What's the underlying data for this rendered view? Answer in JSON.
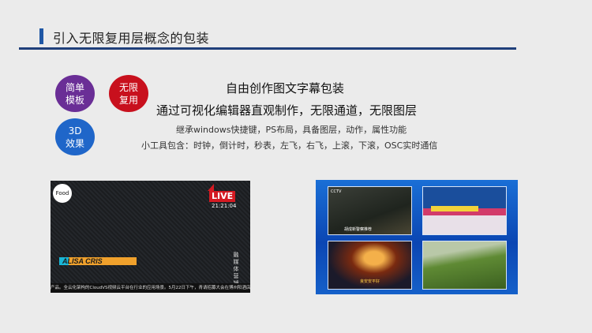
{
  "header": {
    "title": "引入无限复用层概念的包装"
  },
  "badges": {
    "template": [
      "简单",
      "模板"
    ],
    "reuse": [
      "无限",
      "复用"
    ],
    "effects": [
      "3D",
      "效果"
    ]
  },
  "content": {
    "line1": "自由创作图文字幕包装",
    "line2": "通过可视化编辑器直观制作，无限通道，无限图层",
    "line3": "继承windows快捷键，PS布局，具备图层，动作，属性功能",
    "line4": "小工具包含：时钟，倒计时，秒表，左飞，右飞，上滚，下滚，OSC实时通信"
  },
  "left_preview": {
    "logo": "Food",
    "live": "LIVE",
    "clock": "21:21:04",
    "lower_third": "ALISA CRIS",
    "vertical_text": "融媒体营销",
    "ticker": "产品。全云化架构的CloudVS视频云平台在行业的应用场景。5月22日下午，青请招募大会在博州阳酒店举办，与生态"
  },
  "right_preview": {
    "tile1_badge": "CCTV",
    "tile1_caption": "胡成新警察推荐",
    "tile3_caption": "良安安平好"
  },
  "colors": {
    "title_bar": "#1f57a5",
    "rule": "#1f3f7a",
    "badge_template": "#6a2e96",
    "badge_reuse": "#c8101d",
    "badge_effects": "#1f66c9",
    "live": "#d41a22"
  }
}
